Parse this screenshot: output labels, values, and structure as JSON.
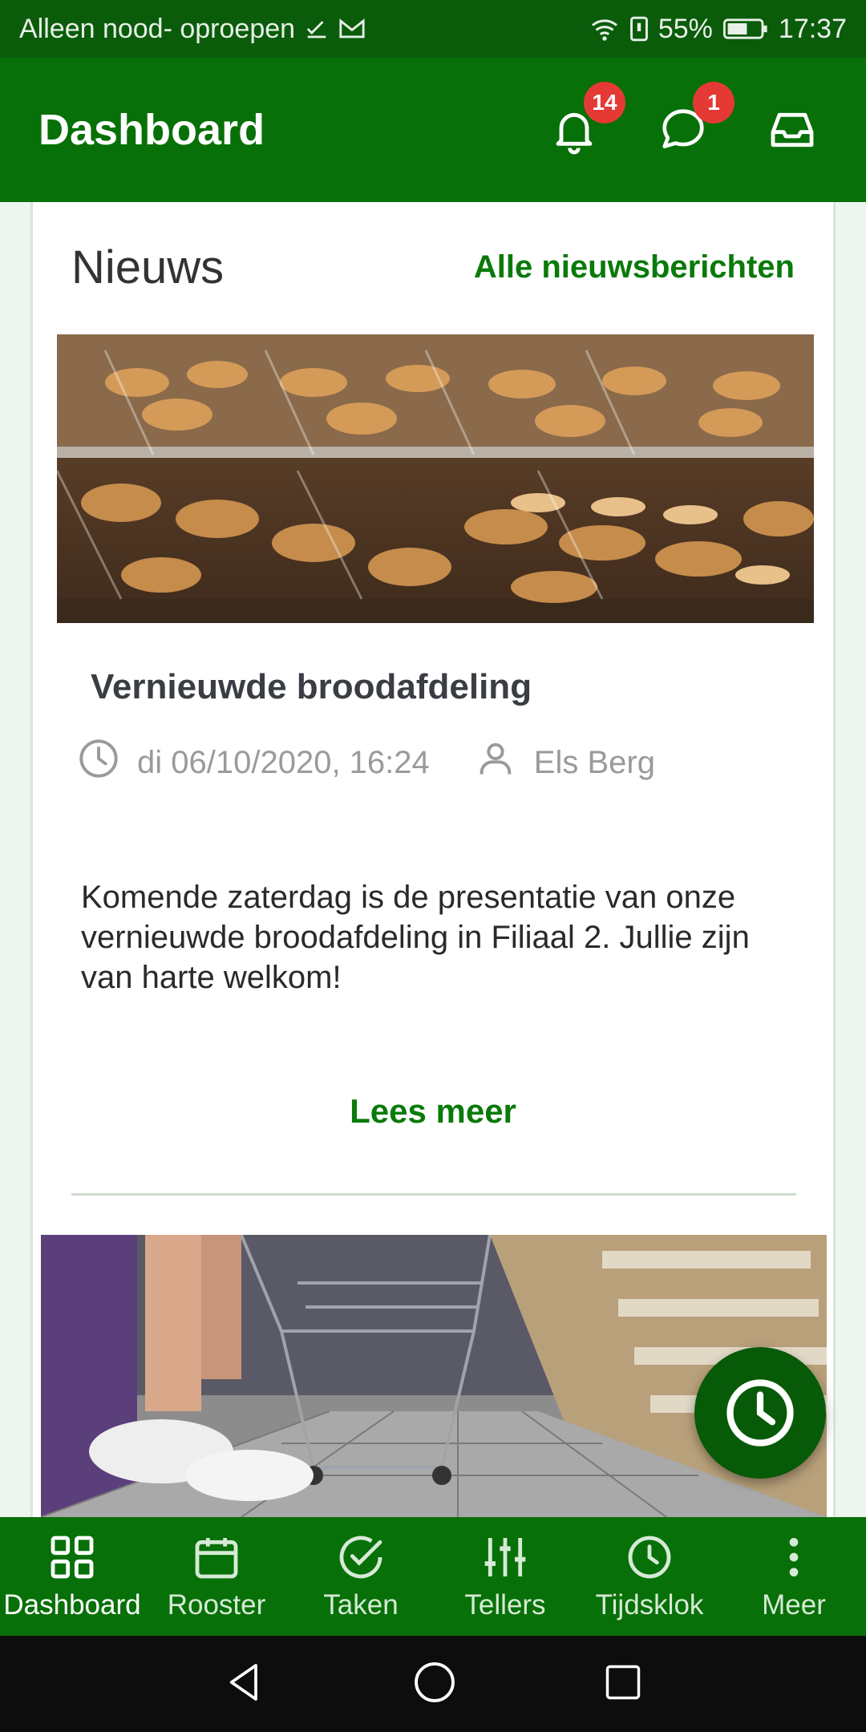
{
  "status_bar": {
    "carrier": "Alleen nood- oproepen",
    "battery": "55%",
    "time": "17:37"
  },
  "header": {
    "title": "Dashboard",
    "notifications_badge": "14",
    "messages_badge": "1"
  },
  "news": {
    "title": "Nieuws",
    "all_link": "Alle nieuwsberichten",
    "article": {
      "title": "Vernieuwde broodafdeling",
      "date": "di 06/10/2020, 16:24",
      "author": "Els Berg",
      "body": "Komende zaterdag is de presentatie van onze vernieuwde broodafdeling in Filiaal 2. Jullie zijn van harte welkom!",
      "read_more": "Lees meer"
    }
  },
  "bottom_nav": {
    "items": [
      {
        "label": "Dashboard",
        "icon": "grid-icon"
      },
      {
        "label": "Rooster",
        "icon": "calendar-icon"
      },
      {
        "label": "Taken",
        "icon": "check-circle-icon"
      },
      {
        "label": "Tellers",
        "icon": "sliders-icon"
      },
      {
        "label": "Tijdsklok",
        "icon": "clock-icon"
      },
      {
        "label": "Meer",
        "icon": "more-vertical-icon"
      }
    ]
  },
  "colors": {
    "primary": "#087008",
    "status_bar": "#0a5c0a",
    "accent_text": "#0a7a0a",
    "badge": "#e53935"
  }
}
